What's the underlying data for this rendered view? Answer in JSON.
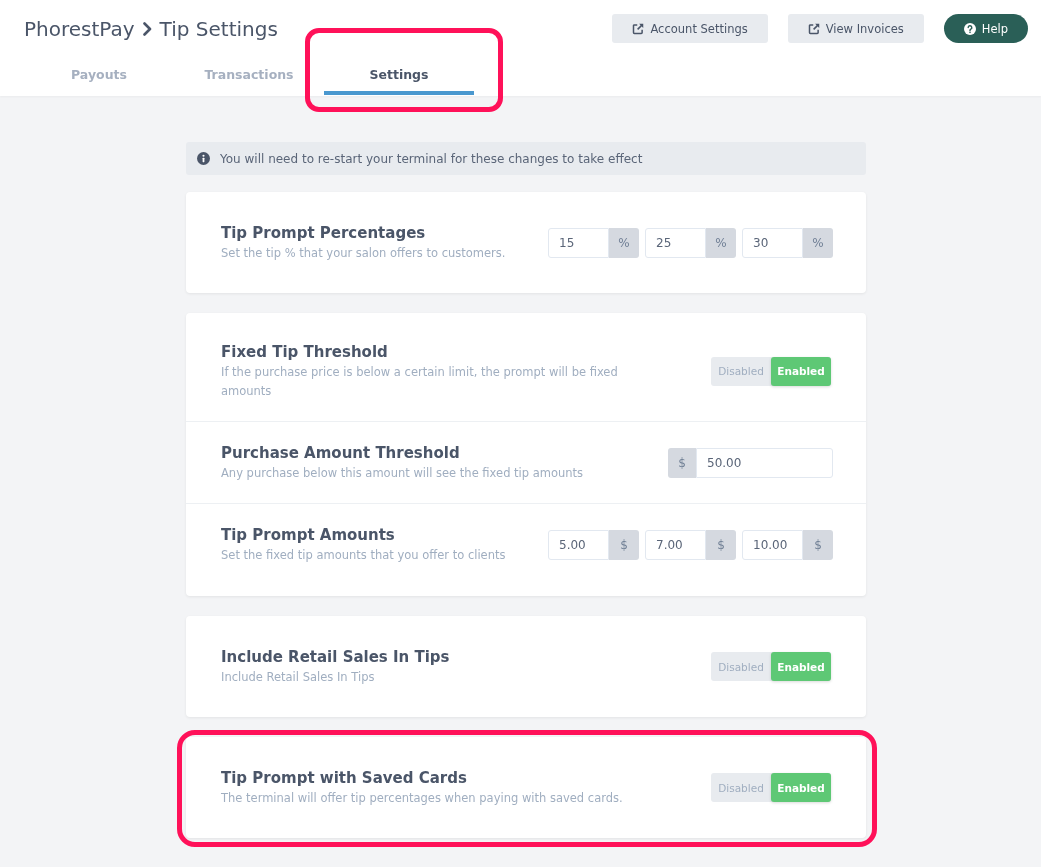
{
  "header": {
    "breadcrumb": [
      {
        "label": "PhorestPay"
      },
      {
        "label": "Tip Settings"
      }
    ],
    "buttons": [
      {
        "label": "Account Settings",
        "kind": "external"
      },
      {
        "label": "View Invoices",
        "kind": "external"
      },
      {
        "label": "Help",
        "kind": "help"
      }
    ]
  },
  "tabs": [
    {
      "label": "Payouts",
      "selected": false,
      "highlighted": false
    },
    {
      "label": "Transactions",
      "selected": false,
      "highlighted": false
    },
    {
      "label": "Settings",
      "selected": true,
      "highlighted": true
    }
  ],
  "notice": {
    "text": "You will need to re-start your terminal for these changes to take effect"
  },
  "cards": [
    {
      "highlighted": false,
      "rows": [
        {
          "kind": "inputs",
          "title": "Tip Prompt Percentages",
          "description": "Set the tip % that your salon offers to customers.",
          "inputs": [
            {
              "value": "15",
              "unit": "%",
              "kind": "suffix"
            },
            {
              "value": "25",
              "unit": "%",
              "kind": "suffix"
            },
            {
              "value": "30",
              "unit": "%",
              "kind": "suffix"
            }
          ]
        }
      ]
    },
    {
      "highlighted": false,
      "rows": [
        {
          "kind": "toggle",
          "title": "Fixed Tip Threshold",
          "description": "If the purchase price is below a certain limit, the prompt will be fixed amounts",
          "options": [
            {
              "label": "Disabled",
              "selected": false
            },
            {
              "label": "Enabled",
              "selected": true
            }
          ]
        },
        {
          "kind": "inputs",
          "title": "Purchase Amount Threshold",
          "description": "Any purchase below this amount will see the fixed tip amounts",
          "inputs": [
            {
              "value": "50.00",
              "unit": "$",
              "kind": "prefix"
            }
          ]
        },
        {
          "kind": "inputs",
          "title": "Tip Prompt Amounts",
          "description": "Set the fixed tip amounts that you offer to clients",
          "inputs": [
            {
              "value": "5.00",
              "unit": "$",
              "kind": "suffix"
            },
            {
              "value": "7.00",
              "unit": "$",
              "kind": "suffix"
            },
            {
              "value": "10.00",
              "unit": "$",
              "kind": "suffix"
            }
          ]
        }
      ]
    },
    {
      "highlighted": false,
      "rows": [
        {
          "kind": "toggle",
          "title": "Include Retail Sales In Tips",
          "description": "Include Retail Sales In Tips",
          "options": [
            {
              "label": "Disabled",
              "selected": false
            },
            {
              "label": "Enabled",
              "selected": true
            }
          ]
        }
      ]
    },
    {
      "highlighted": true,
      "rows": [
        {
          "kind": "toggle",
          "title": "Tip Prompt with Saved Cards",
          "description": "The terminal will offer tip percentages when paying with saved cards.",
          "options": [
            {
              "label": "Disabled",
              "selected": false
            },
            {
              "label": "Enabled",
              "selected": true
            }
          ]
        }
      ]
    }
  ]
}
